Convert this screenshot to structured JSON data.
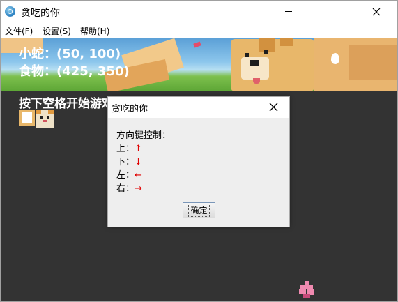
{
  "window": {
    "title": "贪吃的你",
    "icon": "app-snake-icon",
    "controls": {
      "minimize": "minimize-icon",
      "maximize": "maximize-icon",
      "close": "close-icon"
    }
  },
  "menubar": {
    "items": [
      {
        "label": "文件(F)"
      },
      {
        "label": "设置(S)"
      },
      {
        "label": "帮助(H)"
      }
    ]
  },
  "game": {
    "snake_label": "小蛇：(50, 100)",
    "food_label": "食物：(425, 350)",
    "start_hint": "按下空格开始游戏",
    "background_color": "#333333"
  },
  "dialog": {
    "title": "贪吃的你",
    "heading": "方向键控制：",
    "lines": [
      {
        "label": "上：",
        "arrow": "↑"
      },
      {
        "label": "下：",
        "arrow": "↓"
      },
      {
        "label": "左：",
        "arrow": "←"
      },
      {
        "label": "右：",
        "arrow": "→"
      }
    ],
    "ok_label": "确定",
    "arrow_color": "#e00000"
  }
}
